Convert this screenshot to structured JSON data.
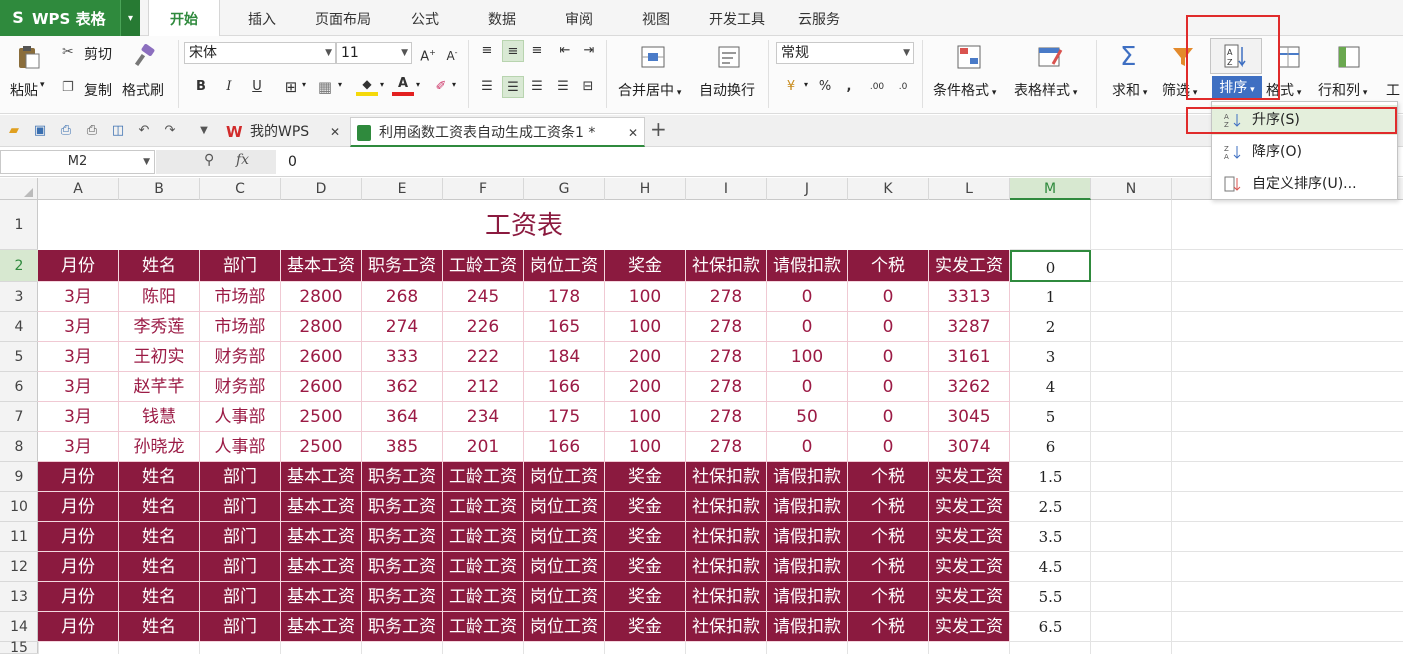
{
  "app": {
    "logo": "S",
    "name": "WPS 表格"
  },
  "menu_tabs": [
    "开始",
    "插入",
    "页面布局",
    "公式",
    "数据",
    "审阅",
    "视图",
    "开发工具",
    "云服务"
  ],
  "ribbon": {
    "paste": "粘贴",
    "cut": "剪切",
    "copy": "复制",
    "format_painter": "格式刷",
    "font_name": "宋体",
    "font_size": "11",
    "bold": "B",
    "italic": "I",
    "underline": "U",
    "merge_center": "合并居中",
    "wrap_text": "自动换行",
    "number_format": "常规",
    "percent": "%",
    "comma": ",",
    "cond_format": "条件格式",
    "table_style": "表格样式",
    "sum": "求和",
    "filter": "筛选",
    "sort": "排序",
    "format": "格式",
    "rows_cols": "行和列",
    "worksheet_partial": "工"
  },
  "doc_tabs": [
    {
      "label": "我的WPS"
    },
    {
      "label": "利用函数工资表自动生成工资条1 *"
    }
  ],
  "formula_bar": {
    "name_box": "M2",
    "fx": "fx",
    "value": "0"
  },
  "columns": [
    "A",
    "B",
    "C",
    "D",
    "E",
    "F",
    "G",
    "H",
    "I",
    "J",
    "K",
    "L",
    "M",
    "N"
  ],
  "rows": [
    "1",
    "2",
    "3",
    "4",
    "5",
    "6",
    "7",
    "8",
    "9",
    "10",
    "11",
    "12",
    "13",
    "14",
    "15"
  ],
  "sheet": {
    "title": "工资表",
    "header": [
      "月份",
      "姓名",
      "部门",
      "基本工资",
      "职务工资",
      "工龄工资",
      "岗位工资",
      "奖金",
      "社保扣款",
      "请假扣款",
      "个税",
      "实发工资"
    ],
    "records": [
      [
        "3月",
        "陈阳",
        "市场部",
        "2800",
        "268",
        "245",
        "178",
        "100",
        "278",
        "0",
        "0",
        "3313"
      ],
      [
        "3月",
        "李秀莲",
        "市场部",
        "2800",
        "274",
        "226",
        "165",
        "100",
        "278",
        "0",
        "0",
        "3287"
      ],
      [
        "3月",
        "王初实",
        "财务部",
        "2600",
        "333",
        "222",
        "184",
        "200",
        "278",
        "100",
        "0",
        "3161"
      ],
      [
        "3月",
        "赵芊芊",
        "财务部",
        "2600",
        "362",
        "212",
        "166",
        "200",
        "278",
        "0",
        "0",
        "3262"
      ],
      [
        "3月",
        "钱慧",
        "人事部",
        "2500",
        "364",
        "234",
        "175",
        "100",
        "278",
        "50",
        "0",
        "3045"
      ],
      [
        "3月",
        "孙晓龙",
        "人事部",
        "2500",
        "385",
        "201",
        "166",
        "100",
        "278",
        "0",
        "0",
        "3074"
      ]
    ],
    "helper_col": [
      "0",
      "1",
      "2",
      "3",
      "4",
      "5",
      "6",
      "1.5",
      "2.5",
      "3.5",
      "4.5",
      "5.5",
      "6.5"
    ]
  },
  "sort_menu": [
    {
      "label": "升序(S)"
    },
    {
      "label": "降序(O)"
    },
    {
      "label": "自定义排序(U)..."
    }
  ],
  "colors": {
    "brand": "#2f8a3d",
    "header_fill": "#8b1a3f",
    "data_text": "#9b1b45",
    "highlight": "#e02b2b"
  }
}
